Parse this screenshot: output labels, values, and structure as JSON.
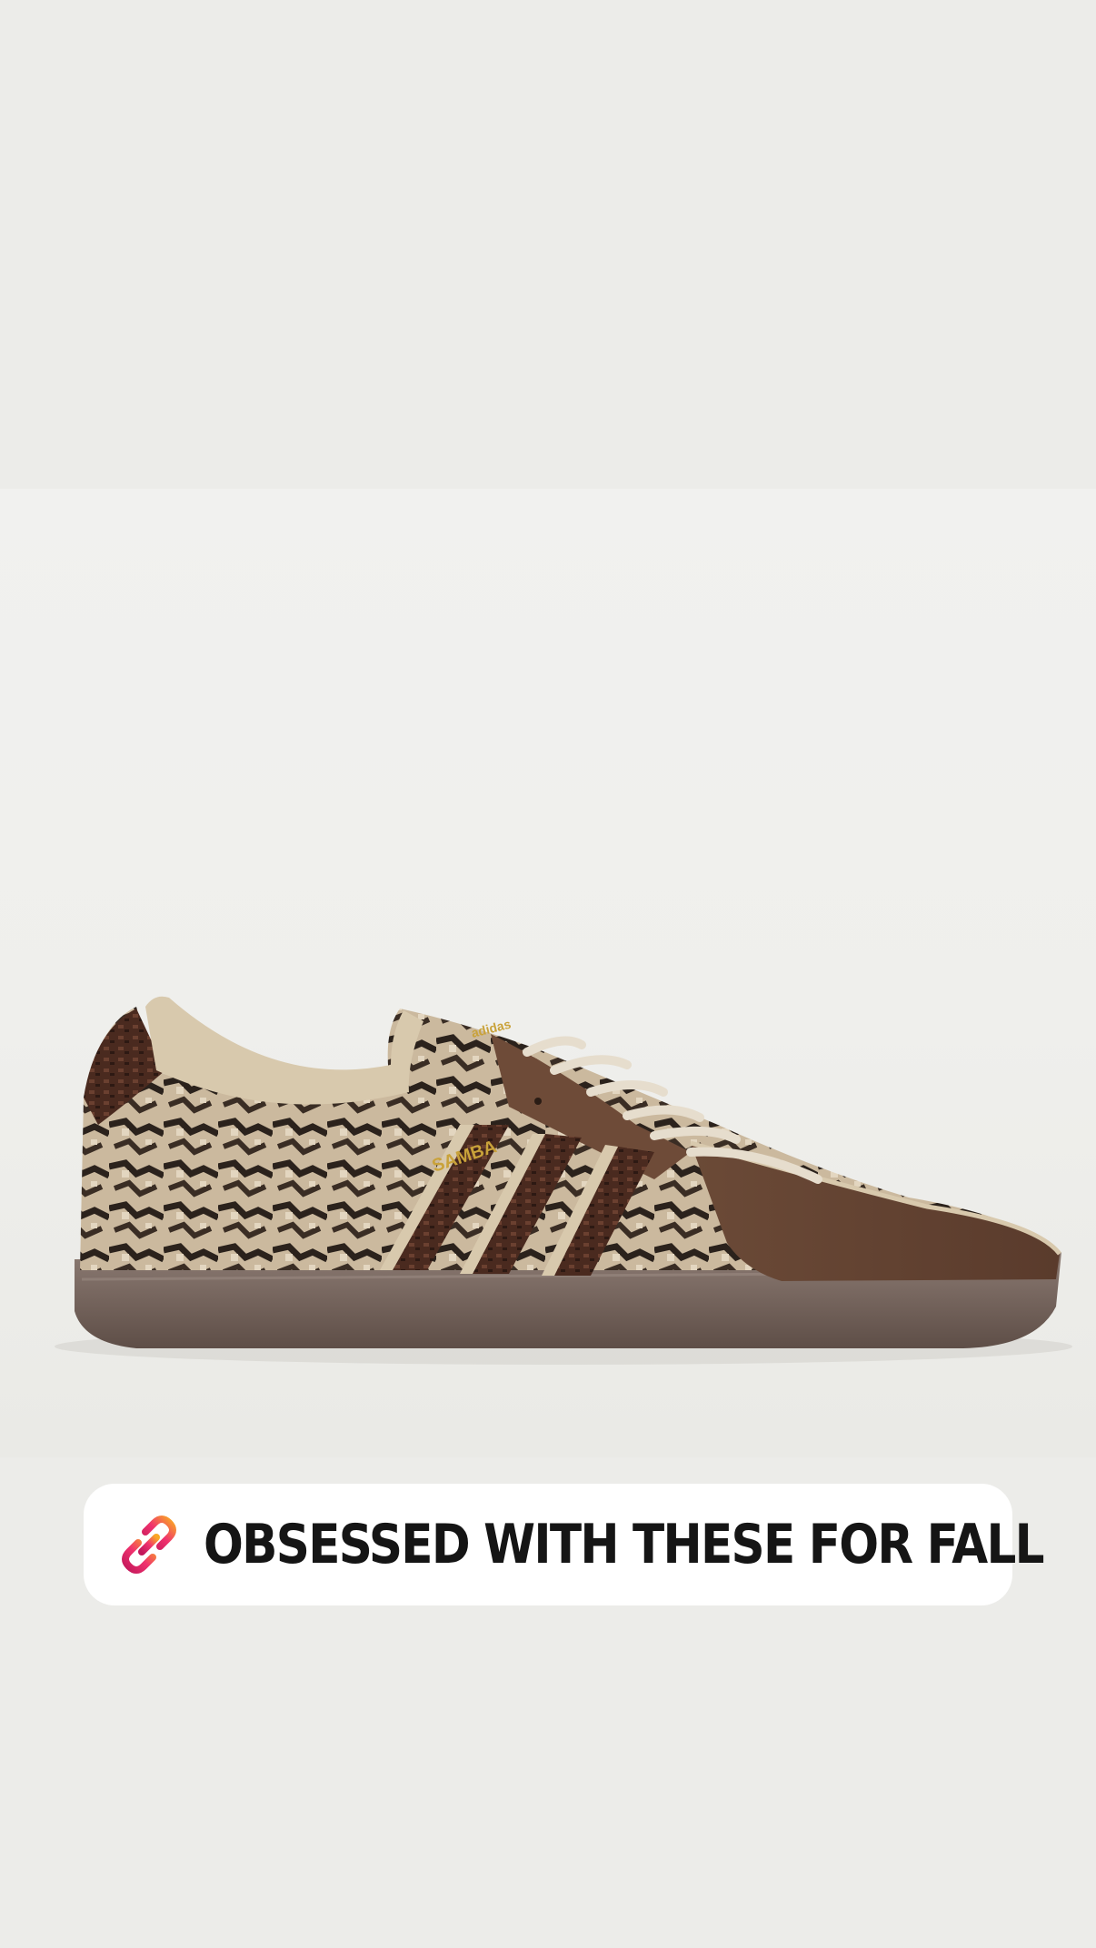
{
  "story": {
    "background_color": "#ecece9",
    "image": {
      "subject": "snakeskin sneaker",
      "shoe_logo_text": "SAMBA"
    },
    "link_sticker": {
      "icon": "link-icon",
      "label": "OBSESSED WITH THESE FOR FALL",
      "gradient_colors": [
        "#f9a825",
        "#e91e63",
        "#c2185b"
      ]
    }
  }
}
